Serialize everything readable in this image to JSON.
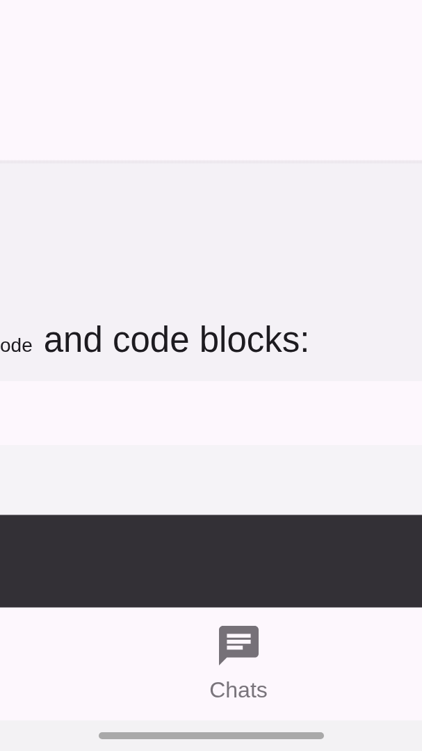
{
  "message": {
    "segments": [
      {
        "kind": "code",
        "text": "ode"
      },
      {
        "kind": "text",
        "text": "and code blocks:"
      }
    ]
  },
  "bottom_nav": {
    "items": [
      {
        "label": "Chats"
      }
    ]
  }
}
